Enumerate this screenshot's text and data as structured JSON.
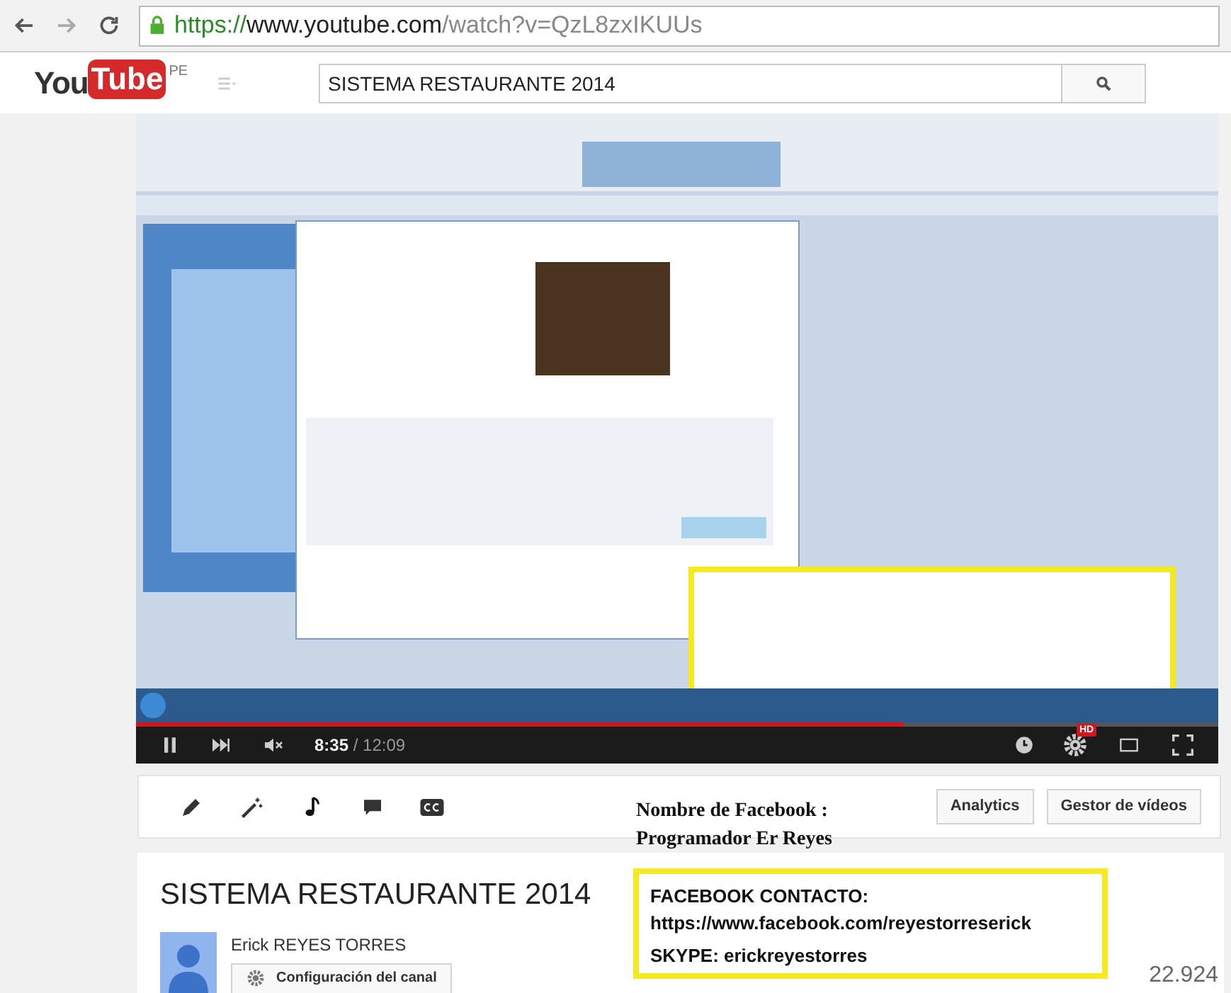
{
  "browser": {
    "url_scheme": "https://",
    "url_host": "www.youtube.com",
    "url_path": "/watch?v=QzL8zxIKUUs"
  },
  "header": {
    "logo_you": "You",
    "logo_tube": "Tube",
    "region": "PE",
    "search": {
      "value": "SISTEMA RESTAURANTE 2014"
    }
  },
  "player": {
    "progress": {
      "level": 0.71
    },
    "playing": true,
    "muted": true,
    "time_current": "8:35",
    "time_total": "/ 12:09",
    "hd_badge": "HD"
  },
  "toolbar": {
    "buttons": [
      "Analytics",
      "Gestor de vídeos"
    ]
  },
  "overlay": {
    "name_lines": [
      "Nombre de Facebook :",
      "Programador Er Reyes"
    ],
    "contact_lines": [
      "FACEBOOK CONTACTO:",
      "https://www.facebook.com/reyestorreserick",
      "SKYPE: erickreyestorres"
    ]
  },
  "video_info": {
    "title": "SISTEMA RESTAURANTE 2014",
    "channel": "Erick REYES TORRES",
    "settings_button": "Configuración del canal",
    "views": "22.924"
  }
}
